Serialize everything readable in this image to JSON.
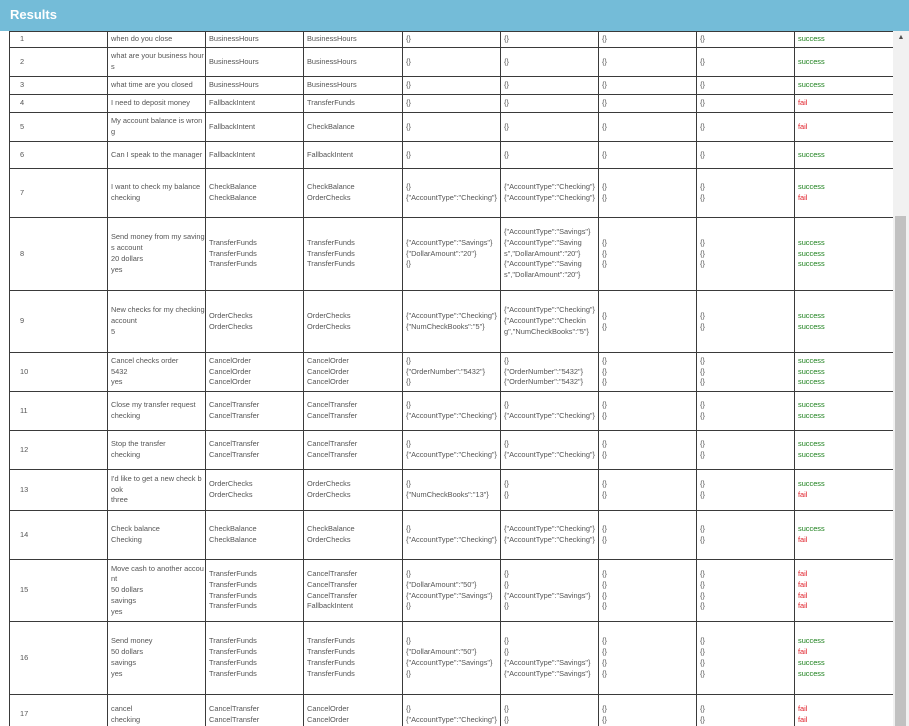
{
  "header": {
    "title": "Results"
  },
  "rows": [
    {
      "num": "1",
      "utter": "when do you close",
      "expected": "BusinessHours",
      "actual": "BusinessHours",
      "exp_slots": "{}",
      "act_slots": "{}",
      "c7": "{}",
      "c8": "{}",
      "status": [
        {
          "t": "success",
          "ok": true
        }
      ]
    },
    {
      "num": "2",
      "utter": "what are your business hours",
      "expected": "BusinessHours",
      "actual": "BusinessHours",
      "exp_slots": "{}",
      "act_slots": "{}",
      "c7": "{}",
      "c8": "{}",
      "status": [
        {
          "t": "success",
          "ok": true
        }
      ]
    },
    {
      "num": "3",
      "utter": "what time are you closed",
      "expected": "BusinessHours",
      "actual": "BusinessHours",
      "exp_slots": "{}",
      "act_slots": "{}",
      "c7": "{}",
      "c8": "{}",
      "status": [
        {
          "t": "success",
          "ok": true
        }
      ]
    },
    {
      "num": "4",
      "utter": "I need to deposit money",
      "expected": "FallbackIntent",
      "actual": "TransferFunds",
      "exp_slots": "{}",
      "act_slots": "{}",
      "c7": "{}",
      "c8": "{}",
      "status": [
        {
          "t": "fail",
          "ok": false
        }
      ]
    },
    {
      "num": "5",
      "utter": "My account balance is wrong",
      "expected": "FallbackIntent",
      "actual": "CheckBalance",
      "exp_slots": "{}",
      "act_slots": "{}",
      "c7": "{}",
      "c8": "{}",
      "status": [
        {
          "t": "fail",
          "ok": false
        }
      ]
    },
    {
      "num": "6",
      "utter": "Can I speak to the manager",
      "expected": "FallbackIntent",
      "actual": "FallbackIntent",
      "exp_slots": "{}",
      "act_slots": "{}",
      "c7": "{}",
      "c8": "{}",
      "status": [
        {
          "t": "success",
          "ok": true
        }
      ]
    },
    {
      "num": "7",
      "utter": "I want to check my balance\nchecking",
      "expected": "CheckBalance\nCheckBalance",
      "actual": "CheckBalance\nOrderChecks",
      "exp_slots": "{}\n{\"AccountType\":\"Checking\"}",
      "act_slots": "{\"AccountType\":\"Checking\"}\n{\"AccountType\":\"Checking\"}",
      "c7": "{}\n{}",
      "c8": "{}\n{}",
      "status": [
        {
          "t": "success",
          "ok": true
        },
        {
          "t": "fail",
          "ok": false
        }
      ]
    },
    {
      "num": "8",
      "utter": "Send money from my savings account\n20 dollars\nyes",
      "expected": "TransferFunds\nTransferFunds\nTransferFunds",
      "actual": "TransferFunds\nTransferFunds\nTransferFunds",
      "exp_slots": "{\"AccountType\":\"Savings\"}\n{\"DollarAmount\":\"20\"}\n{}",
      "act_slots": "{\"AccountType\":\"Savings\"}\n{\"AccountType\":\"Savings\",\"DollarAmount\":\"20\"}\n{\"AccountType\":\"Savings\",\"DollarAmount\":\"20\"}",
      "c7": "{}\n{}\n{}",
      "c8": "{}\n{}\n{}",
      "status": [
        {
          "t": "success",
          "ok": true
        },
        {
          "t": "success",
          "ok": true
        },
        {
          "t": "success",
          "ok": true
        }
      ]
    },
    {
      "num": "9",
      "utter": "New checks for my checking account\n5",
      "expected": "OrderChecks\nOrderChecks",
      "actual": "OrderChecks\nOrderChecks",
      "exp_slots": "{\"AccountType\":\"Checking\"}\n{\"NumCheckBooks\":\"5\"}",
      "act_slots": "{\"AccountType\":\"Checking\"}\n{\"AccountType\":\"Checking\",\"NumCheckBooks\":\"5\"}",
      "c7": "{}\n{}",
      "c8": "{}\n{}",
      "status": [
        {
          "t": "success",
          "ok": true
        },
        {
          "t": "success",
          "ok": true
        }
      ]
    },
    {
      "num": "10",
      "utter": "Cancel checks order\n5432\nyes",
      "expected": "CancelOrder\nCancelOrder\nCancelOrder",
      "actual": "CancelOrder\nCancelOrder\nCancelOrder",
      "exp_slots": "{}\n{\"OrderNumber\":\"5432\"}\n{}",
      "act_slots": "{}\n{\"OrderNumber\":\"5432\"}\n{\"OrderNumber\":\"5432\"}",
      "c7": "{}\n{}\n{}",
      "c8": "{}\n{}\n{}",
      "status": [
        {
          "t": "success",
          "ok": true
        },
        {
          "t": "success",
          "ok": true
        },
        {
          "t": "success",
          "ok": true
        }
      ]
    },
    {
      "num": "11",
      "utter": "Close my transfer request\nchecking",
      "expected": "CancelTransfer\nCancelTransfer",
      "actual": "CancelTransfer\nCancelTransfer",
      "exp_slots": "{}\n{\"AccountType\":\"Checking\"}",
      "act_slots": "{}\n{\"AccountType\":\"Checking\"}",
      "c7": "{}\n{}",
      "c8": "{}\n{}",
      "status": [
        {
          "t": "success",
          "ok": true
        },
        {
          "t": "success",
          "ok": true
        }
      ]
    },
    {
      "num": "12",
      "utter": "Stop the transfer\nchecking",
      "expected": "CancelTransfer\nCancelTransfer",
      "actual": "CancelTransfer\nCancelTransfer",
      "exp_slots": "{}\n{\"AccountType\":\"Checking\"}",
      "act_slots": "{}\n{\"AccountType\":\"Checking\"}",
      "c7": "{}\n{}",
      "c8": "{}\n{}",
      "status": [
        {
          "t": "success",
          "ok": true
        },
        {
          "t": "success",
          "ok": true
        }
      ]
    },
    {
      "num": "13",
      "utter": "I'd like to get a new check book\nthree",
      "expected": "OrderChecks\nOrderChecks",
      "actual": "OrderChecks\nOrderChecks",
      "exp_slots": "{}\n{\"NumCheckBooks\":\"13\"}",
      "act_slots": "{}\n{}",
      "c7": "{}\n{}",
      "c8": "{}\n{}",
      "status": [
        {
          "t": "success",
          "ok": true
        },
        {
          "t": "fail",
          "ok": false
        }
      ]
    },
    {
      "num": "14",
      "utter": "Check balance\nChecking",
      "expected": "CheckBalance\nCheckBalance",
      "actual": "CheckBalance\nOrderChecks",
      "exp_slots": "{}\n{\"AccountType\":\"Checking\"}",
      "act_slots": "{\"AccountType\":\"Checking\"}\n{\"AccountType\":\"Checking\"}",
      "c7": "{}\n{}",
      "c8": "{}\n{}",
      "status": [
        {
          "t": "success",
          "ok": true
        },
        {
          "t": "fail",
          "ok": false
        }
      ]
    },
    {
      "num": "15",
      "utter": "Move cash to another account\n50 dollars\nsavings\nyes",
      "expected": "TransferFunds\nTransferFunds\nTransferFunds\nTransferFunds",
      "actual": "CancelTransfer\nCancelTransfer\nCancelTransfer\nFallbackIntent",
      "exp_slots": "{}\n{\"DollarAmount\":\"50\"}\n{\"AccountType\":\"Savings\"}\n{}",
      "act_slots": "{}\n{}\n{\"AccountType\":\"Savings\"}\n{}",
      "c7": "{}\n{}\n{}\n{}",
      "c8": "{}\n{}\n{}\n{}",
      "status": [
        {
          "t": "fail",
          "ok": false
        },
        {
          "t": "fail",
          "ok": false
        },
        {
          "t": "fail",
          "ok": false
        },
        {
          "t": "fail",
          "ok": false
        }
      ]
    },
    {
      "num": "16",
      "utter": "Send money\n50 dollars\nsavings\nyes",
      "expected": "TransferFunds\nTransferFunds\nTransferFunds\nTransferFunds",
      "actual": "TransferFunds\nTransferFunds\nTransferFunds\nTransferFunds",
      "exp_slots": "{}\n{\"DollarAmount\":\"50\"}\n{\"AccountType\":\"Savings\"}\n{}",
      "act_slots": "{}\n{}\n{\"AccountType\":\"Savings\"}\n{\"AccountType\":\"Savings\"}",
      "c7": "{}\n{}\n{}\n{}",
      "c8": "{}\n{}\n{}\n{}",
      "status": [
        {
          "t": "success",
          "ok": true
        },
        {
          "t": "fail",
          "ok": false
        },
        {
          "t": "success",
          "ok": true
        },
        {
          "t": "success",
          "ok": true
        }
      ]
    },
    {
      "num": "17",
      "utter": "cancel\nchecking",
      "expected": "CancelTransfer\nCancelTransfer",
      "actual": "CancelOrder\nCancelOrder",
      "exp_slots": "{}\n{\"AccountType\":\"Checking\"}",
      "act_slots": "{}\n{}",
      "c7": "{}\n{}",
      "c8": "{}\n{}",
      "status": [
        {
          "t": "fail",
          "ok": false
        },
        {
          "t": "fail",
          "ok": false
        }
      ]
    }
  ]
}
